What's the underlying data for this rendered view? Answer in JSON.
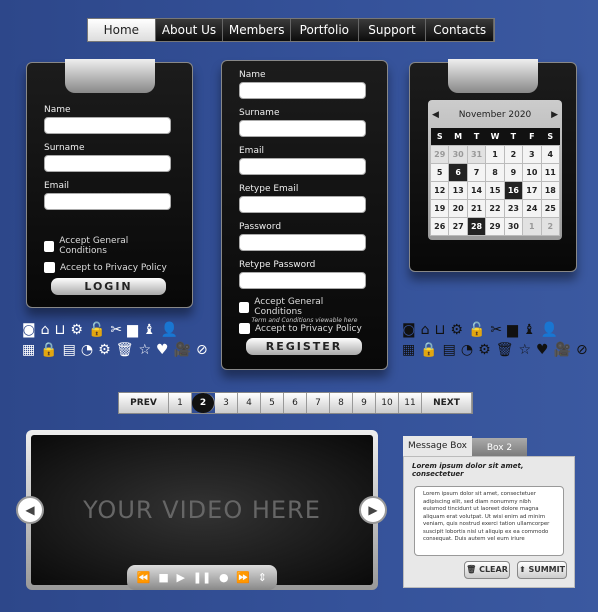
{
  "nav": {
    "items": [
      "Home",
      "About Us",
      "Members",
      "Portfolio",
      "Support",
      "Contacts"
    ],
    "active": "Home"
  },
  "login": {
    "fields": [
      "Name",
      "Surname",
      "Email"
    ],
    "checkboxes": [
      "Accept General Conditions",
      "Accept to Privacy Policy"
    ],
    "button": "LOGIN"
  },
  "register": {
    "fields": [
      "Name",
      "Surname",
      "Email",
      "Retype Email",
      "Password",
      "Retype Password"
    ],
    "checkboxes": [
      "Accept General Conditions",
      "Accept to Privacy Policy"
    ],
    "terms": "Term and Conditions viewable here",
    "button": "REGISTER"
  },
  "calendar": {
    "title": "November 2020",
    "days": [
      "S",
      "M",
      "T",
      "W",
      "T",
      "F",
      "S"
    ],
    "weeks": [
      [
        "29",
        "30",
        "31",
        "1",
        "2",
        "3",
        "4"
      ],
      [
        "5",
        "6",
        "7",
        "8",
        "9",
        "10",
        "11"
      ],
      [
        "12",
        "13",
        "14",
        "15",
        "16",
        "17",
        "18"
      ],
      [
        "19",
        "20",
        "21",
        "22",
        "23",
        "24",
        "25"
      ],
      [
        "26",
        "27",
        "28",
        "29",
        "30",
        "1",
        "2"
      ]
    ],
    "highlighted": [
      "6",
      "16",
      "28"
    ]
  },
  "icons": {
    "row1": [
      "rss-icon",
      "home-icon",
      "basket-icon",
      "gear-icon",
      "unlock-icon",
      "scissors-icon",
      "briefcase-icon",
      "chess-icon",
      "user-icon"
    ],
    "row2": [
      "calendar-icon",
      "lock-icon",
      "calculator-icon",
      "pie-chart-icon",
      "gears-icon",
      "trash-icon",
      "star-icon",
      "heart-icon",
      "video-camera-icon",
      "ban-icon"
    ]
  },
  "pagination": {
    "prev": "PREV",
    "next": "NEXT",
    "pages": [
      "1",
      "2",
      "3",
      "4",
      "5",
      "6",
      "7",
      "8",
      "9",
      "10",
      "11"
    ],
    "current": "2"
  },
  "video": {
    "placeholder": "YOUR VIDEO HERE"
  },
  "message": {
    "tabs": [
      "Message Box",
      "Box 2"
    ],
    "heading": "Lorem ipsum dolor sit amet, consectetuer",
    "body": "Lorem ipsum dolor sit amet, consectetuer adipiscing elit, sed diam nonummy nibh euismod tincidunt ut laoreet dolore magna aliquam erat volutpat. Ut wisi enim ad minim veniam, quis nostrud exerci tation ullamcorper suscipit lobortis nisl ut aliquip ex ea commodo consequat. Duis autem vel eum iriure",
    "clear": "CLEAR",
    "submit": "SUMMIT"
  }
}
